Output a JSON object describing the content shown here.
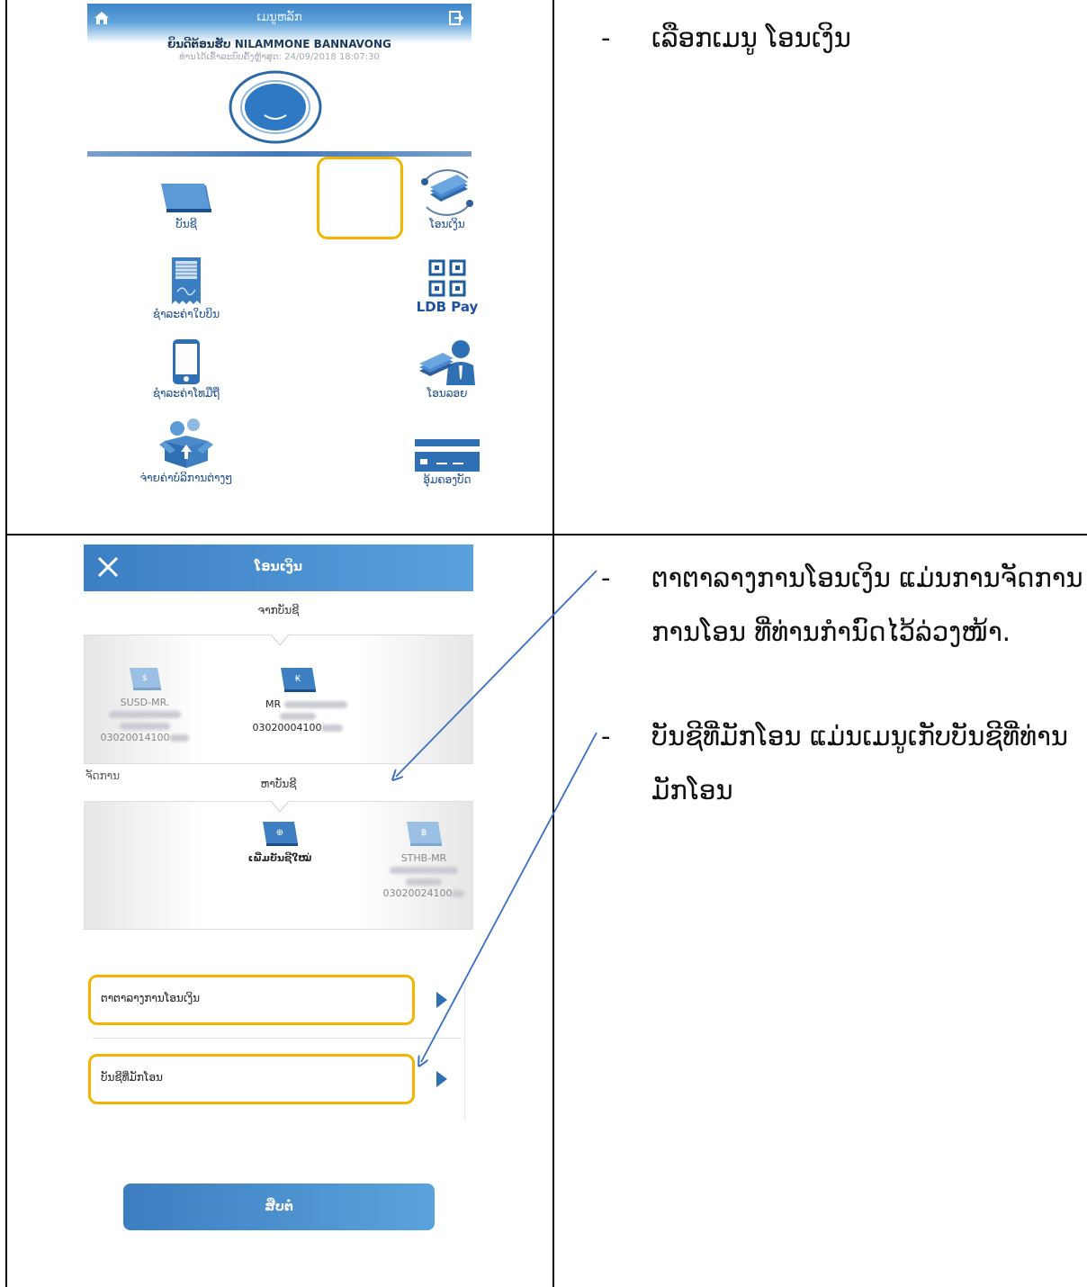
{
  "screen1": {
    "title": "ເມນູຫລັກ",
    "welcome": "ຍິນດີຕ້ອນຮັບ NILAMMONE BANNAVONG",
    "last_login": "ທ່ານໄດ້ເຂົ້າລະບົບຄັ້ງຫຼ້າສຸດ: 24/09/2018 18:07:30",
    "tiles": [
      {
        "label": "ບັນຊີ",
        "icon": "account-book-icon"
      },
      {
        "label": "ໂອນເງິນ",
        "icon": "money-transfer-icon"
      },
      {
        "label": "ຊຳລະຄ່າໃບບິນ",
        "icon": "bill-receipt-icon"
      },
      {
        "label": "LDB Pay",
        "icon": "qr-code-icon"
      },
      {
        "label": "ຊຳລະຄ່າໂທມືຖື",
        "icon": "mobile-phone-icon"
      },
      {
        "label": "ໂອນລອຍ",
        "icon": "cash-handover-icon"
      },
      {
        "label": "ຈ່າຍຄ່າບໍລິການຕ່າງໆ",
        "icon": "service-box-icon"
      },
      {
        "label": "ອຸ້ມຄອງບັດ",
        "icon": "card-icon"
      }
    ]
  },
  "screen2": {
    "title": "ໂອນເງິນ",
    "from_title": "ຈາກບັນຊີ",
    "to_title": "ຫາບັນຊີ",
    "from_accounts": [
      {
        "name": "SUSD-MR.",
        "number": "03020014100",
        "currency": "$"
      },
      {
        "name": "MR",
        "number": "03020004100",
        "currency": "₭"
      }
    ],
    "to_accounts": [
      {
        "name": "ເພີ່ມບັນຊີໃໝ່",
        "number": "",
        "currency": "⊕"
      },
      {
        "name": "STHB-MR",
        "number": "03020024100",
        "currency": "฿"
      }
    ],
    "manage_title": "ຈັດການ",
    "rows": [
      {
        "label": "ຕາຕາລາງການໂອນເງິນ"
      },
      {
        "label": "ບັນຊີທີ່ມັກໂອນ"
      }
    ],
    "next_button": "ສືບຕໍ່"
  },
  "instructions": {
    "dash": "-",
    "step1": "ເລືອກເມນູ ໂອນເງິນ",
    "step2a": "ຕາຕາລາງການໂອນເງິນ ແມ່ນການຈັດການການໂອນ ທີ່ທ່ານກຳນົດໄວ້ລ່ວງໜ້າ.",
    "step2b": "ບັນຊີທີ່ມັກໂອນ ແມ່ນເມນູເກັບບັນຊີທີ່ທ່ານມັກໂອນ"
  },
  "colors": {
    "highlight": "#f2b400",
    "brand_blue": "#3b7fc4",
    "arrow_blue": "#3a6fc4"
  }
}
